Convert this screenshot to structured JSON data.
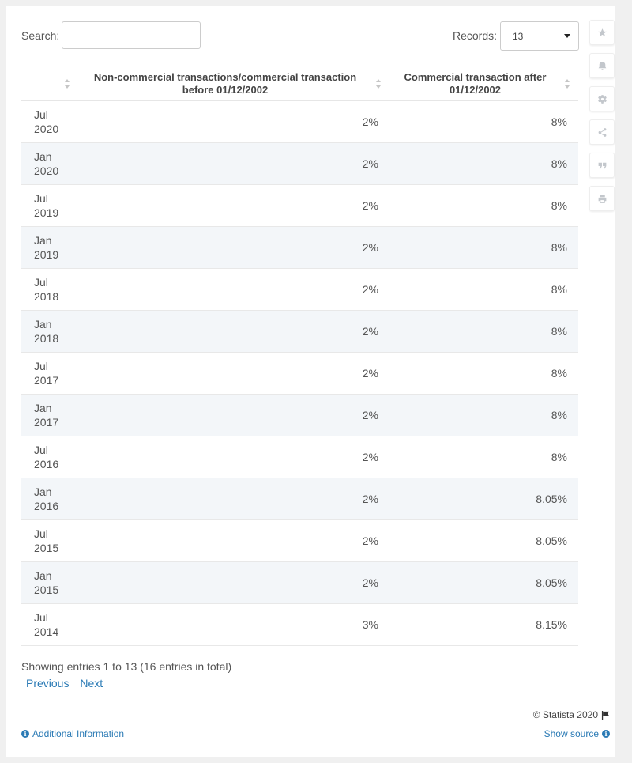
{
  "search": {
    "label": "Search:",
    "value": "",
    "placeholder": ""
  },
  "records": {
    "label": "Records:",
    "selected": "13"
  },
  "sidebar": {
    "icons": [
      "star-icon",
      "bell-icon",
      "gear-icon",
      "share-icon",
      "quote-icon",
      "print-icon"
    ]
  },
  "table": {
    "headers": [
      "",
      "Non-commercial transactions/commercial transaction before 01/12/2002",
      "Commercial transaction after 01/12/2002"
    ],
    "rows": [
      {
        "month": "Jul",
        "year": "2020",
        "noncommercial": "2%",
        "commercial": "8%"
      },
      {
        "month": "Jan",
        "year": "2020",
        "noncommercial": "2%",
        "commercial": "8%"
      },
      {
        "month": "Jul",
        "year": "2019",
        "noncommercial": "2%",
        "commercial": "8%"
      },
      {
        "month": "Jan",
        "year": "2019",
        "noncommercial": "2%",
        "commercial": "8%"
      },
      {
        "month": "Jul",
        "year": "2018",
        "noncommercial": "2%",
        "commercial": "8%"
      },
      {
        "month": "Jan",
        "year": "2018",
        "noncommercial": "2%",
        "commercial": "8%"
      },
      {
        "month": "Jul",
        "year": "2017",
        "noncommercial": "2%",
        "commercial": "8%"
      },
      {
        "month": "Jan",
        "year": "2017",
        "noncommercial": "2%",
        "commercial": "8%"
      },
      {
        "month": "Jul",
        "year": "2016",
        "noncommercial": "2%",
        "commercial": "8%"
      },
      {
        "month": "Jan",
        "year": "2016",
        "noncommercial": "2%",
        "commercial": "8.05%"
      },
      {
        "month": "Jul",
        "year": "2015",
        "noncommercial": "2%",
        "commercial": "8.05%"
      },
      {
        "month": "Jan",
        "year": "2015",
        "noncommercial": "2%",
        "commercial": "8.05%"
      },
      {
        "month": "Jul",
        "year": "2014",
        "noncommercial": "3%",
        "commercial": "8.15%"
      }
    ]
  },
  "footer": {
    "showing": "Showing entries 1 to 13 (16 entries in total)",
    "previous": "Previous",
    "next": "Next",
    "copyright": "© Statista 2020",
    "additional_info": "Additional Information",
    "show_source": "Show source"
  },
  "colors": {
    "link": "#2a7ab5",
    "stripe": "#f3f6f9",
    "icon": "#c3c7cc"
  }
}
